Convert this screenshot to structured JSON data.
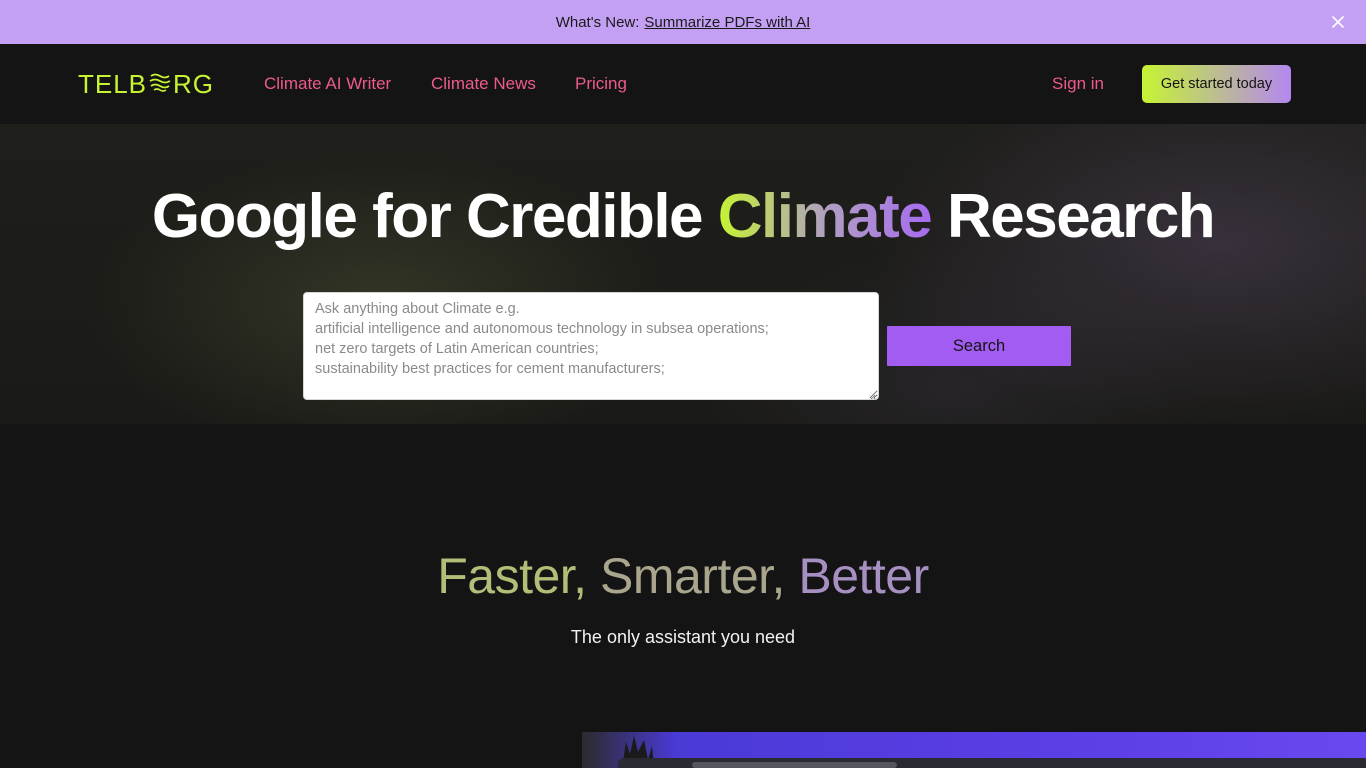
{
  "announcement": {
    "lead": "What's New:",
    "link": "Summarize PDFs with AI",
    "close_icon": "close-icon"
  },
  "nav": {
    "logo": {
      "pre": "TELB",
      "post": "RG",
      "icon": "globe-wave-icon"
    },
    "links": [
      "Climate AI Writer",
      "Climate News",
      "Pricing"
    ],
    "signin": "Sign in",
    "cta": "Get started today"
  },
  "hero": {
    "title_pre": "Google for Credible",
    "title_accent": "Climate",
    "title_post": "Research",
    "search": {
      "placeholder_lines": [
        "Ask anything about Climate e.g.",
        "artificial intelligence and autonomous technology in subsea operations;",
        "net zero targets of Latin American countries;",
        "sustainability best practices for cement manufacturers;"
      ],
      "button": "Search"
    }
  },
  "features": {
    "word1": "Faster,",
    "word2": "Smarter,",
    "word3": "Better",
    "subtitle": "The only assistant you need"
  },
  "colors": {
    "announcement_bg": "#c4a0f5",
    "background": "#141414",
    "brand_lime": "#c6f432",
    "brand_purple": "#a35cf2",
    "nav_link": "#ee5b8a"
  }
}
